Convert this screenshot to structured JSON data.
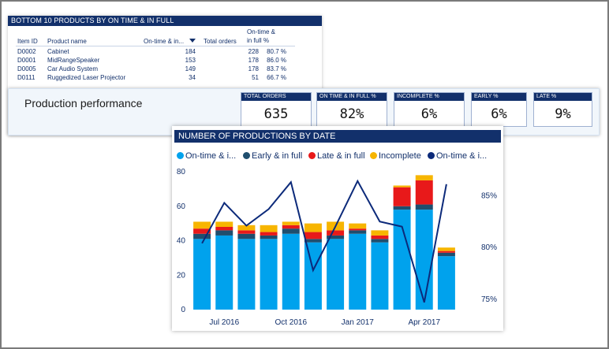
{
  "table": {
    "title": "BOTTOM 10 PRODUCTS BY ON TIME & IN FULL",
    "headers": {
      "item_id": "Item ID",
      "product_name": "Product name",
      "on_time": "On-time & in...",
      "total_orders": "Total orders",
      "pct_line1": "On-time &",
      "pct_line2": "in full %"
    },
    "rows": [
      {
        "id": "D0002",
        "name": "Cabinet",
        "on_time": "184",
        "total": "228",
        "pct": "80.7 %"
      },
      {
        "id": "D0001",
        "name": "MidRangeSpeaker",
        "on_time": "153",
        "total": "178",
        "pct": "86.0 %"
      },
      {
        "id": "D0005",
        "name": "Car Audio System",
        "on_time": "149",
        "total": "178",
        "pct": "83.7 %"
      },
      {
        "id": "D0111",
        "name": "Ruggedized Laser Projector",
        "on_time": "34",
        "total": "51",
        "pct": "66.7 %"
      }
    ]
  },
  "performance": {
    "title": "Production performance",
    "kpis": [
      {
        "label": "TOTAL ORDERS",
        "value": "635"
      },
      {
        "label": "ON TIME & IN FULL %",
        "value": "82%"
      },
      {
        "label": "INCOMPLETE %",
        "value": "6%"
      },
      {
        "label": "EARLY %",
        "value": "6%"
      },
      {
        "label": "LATE %",
        "value": "9%"
      }
    ]
  },
  "colors": {
    "ontime": "#00a2ed",
    "early": "#1f4e6e",
    "late": "#e8191a",
    "incomplete": "#f7b500",
    "line": "#0c2a7a",
    "header": "#12306b"
  },
  "chart_data": {
    "type": "bar",
    "title": "NUMBER OF PRODUCTIONS BY DATE",
    "legend": [
      "On-time & i...",
      "Early & in full",
      "Late & in full",
      "Incomplete",
      "On-time & i..."
    ],
    "x_tick_labels": [
      "Jul 2016",
      "Oct 2016",
      "Jan 2017",
      "Apr 2017"
    ],
    "y_ticks": [
      "0",
      "20",
      "40",
      "60",
      "80"
    ],
    "y2_ticks": [
      "75%",
      "80%",
      "85%"
    ],
    "ylim": [
      0,
      80
    ],
    "y2lim": [
      0.74,
      0.873
    ],
    "stacked": true,
    "categories": [
      "Jun 2016",
      "Jul 2016",
      "Aug 2016",
      "Sep 2016",
      "Oct 2016",
      "Nov 2016",
      "Dec 2016",
      "Jan 2017",
      "Feb 2017",
      "Mar 2017",
      "Apr 2017",
      "May 2017"
    ],
    "series": [
      {
        "name": "On-time & i...",
        "values": [
          41,
          43,
          41,
          41,
          44,
          39,
          41,
          44,
          39,
          58,
          58,
          31
        ]
      },
      {
        "name": "Early & in full",
        "values": [
          3,
          3,
          3,
          2,
          3,
          2,
          2,
          2,
          2,
          2,
          3,
          2
        ]
      },
      {
        "name": "Late & in full",
        "values": [
          3,
          2,
          2,
          2,
          2,
          4,
          3,
          1,
          2,
          11,
          14,
          1
        ]
      },
      {
        "name": "Incomplete",
        "values": [
          4,
          3,
          3,
          4,
          2,
          5,
          5,
          3,
          3,
          1,
          3,
          2
        ]
      }
    ],
    "line": {
      "name": "On-time & i...",
      "values": [
        0.804,
        0.843,
        0.821,
        0.837,
        0.863,
        0.778,
        0.82,
        0.864,
        0.825,
        0.82,
        0.747,
        0.861
      ]
    }
  }
}
